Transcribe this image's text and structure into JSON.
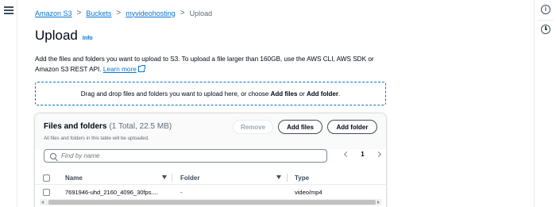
{
  "breadcrumb": {
    "items": [
      "Amazon S3",
      "Buckets",
      "myvideohosting"
    ],
    "current": "Upload",
    "separator": ">"
  },
  "page": {
    "title": "Upload",
    "info_label": "Info"
  },
  "description": {
    "text": "Add the files and folders you want to upload to S3. To upload a file larger than 160GB, use the AWS CLI, AWS SDK or Amazon S3 REST API.",
    "learn_more": "Learn more"
  },
  "dropzone": {
    "prefix": "Drag and drop files and folders you want to upload here, or choose",
    "add_files": "Add files",
    "or": "or",
    "add_folder": "Add folder",
    "suffix": "."
  },
  "files_panel": {
    "title": "Files and folders",
    "count": "(1 Total, 22.5 MB)",
    "subtitle": "All files and folders in this table will be uploaded.",
    "remove_button": "Remove",
    "add_files_button": "Add files",
    "add_folder_button": "Add folder",
    "search_placeholder": "Find by name",
    "current_page": "1",
    "columns": [
      "Name",
      "Folder",
      "Type"
    ],
    "rows": [
      {
        "name": "7691946-uhd_2160_4096_30fps....",
        "folder": "-",
        "type": "video/mp4"
      }
    ]
  },
  "colors": {
    "link": "#0972d3",
    "text": "#000716",
    "muted": "#5f6b7a",
    "border": "#7d8998"
  },
  "icons": [
    "menu-icon",
    "info-icon",
    "history-icon",
    "external-link-icon",
    "search-icon",
    "chevron-left-icon",
    "chevron-right-icon",
    "sort-icon"
  ]
}
